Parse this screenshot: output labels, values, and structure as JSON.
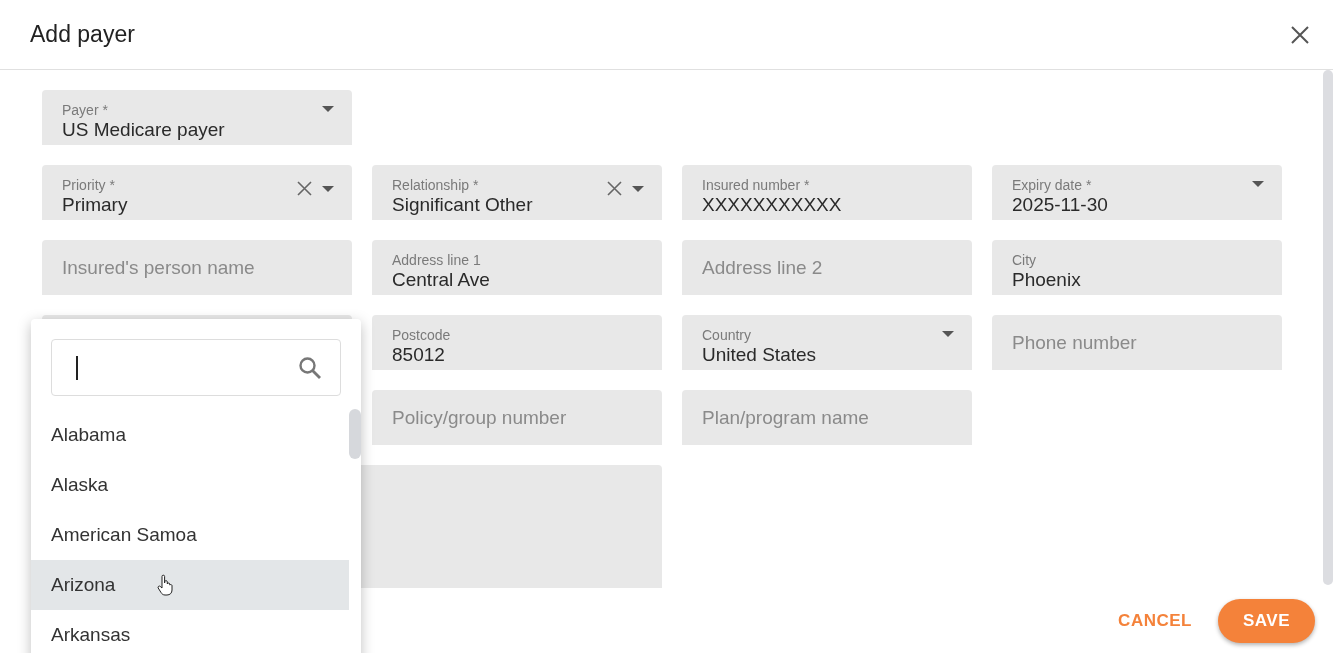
{
  "dialog": {
    "title": "Add payer"
  },
  "rows": [
    [
      {
        "kind": "select",
        "label": "Payer *",
        "value": "US Medicare payer",
        "clearable": false
      }
    ],
    [
      {
        "kind": "select",
        "label": "Priority *",
        "value": "Primary",
        "clearable": true
      },
      {
        "kind": "select",
        "label": "Relationship *",
        "value": "Significant Other",
        "clearable": true
      },
      {
        "kind": "text",
        "label": "Insured number *",
        "value": "XXXXXXXXXXX"
      },
      {
        "kind": "select",
        "label": "Expiry date *",
        "value": "2025-11-30",
        "clearable": false
      }
    ],
    [
      {
        "kind": "text",
        "placeholder": "Insured's person name"
      },
      {
        "kind": "text",
        "label": "Address line 1",
        "value": "Central Ave"
      },
      {
        "kind": "text",
        "placeholder": "Address line 2"
      },
      {
        "kind": "text",
        "label": "City",
        "value": "Phoenix"
      }
    ],
    [
      {
        "kind": "covered"
      },
      {
        "kind": "text",
        "label": "Postcode",
        "value": "85012"
      },
      {
        "kind": "select",
        "label": "Country",
        "value": "United States",
        "clearable": false
      },
      {
        "kind": "text",
        "placeholder": "Phone number"
      }
    ],
    [
      {
        "kind": "blank"
      },
      {
        "kind": "text",
        "placeholder": "Policy/group number"
      },
      {
        "kind": "text",
        "placeholder": "Plan/program name"
      }
    ],
    [
      {
        "kind": "textarea"
      }
    ]
  ],
  "menu": {
    "options": [
      {
        "label": "Alabama",
        "highlighted": false
      },
      {
        "label": "Alaska",
        "highlighted": false
      },
      {
        "label": "American Samoa",
        "highlighted": false
      },
      {
        "label": "Arizona",
        "highlighted": true
      },
      {
        "label": "Arkansas",
        "highlighted": false
      }
    ]
  },
  "buttons": [
    {
      "kind": "text",
      "label": "CANCEL"
    },
    {
      "kind": "filled",
      "label": "SAVE"
    }
  ]
}
